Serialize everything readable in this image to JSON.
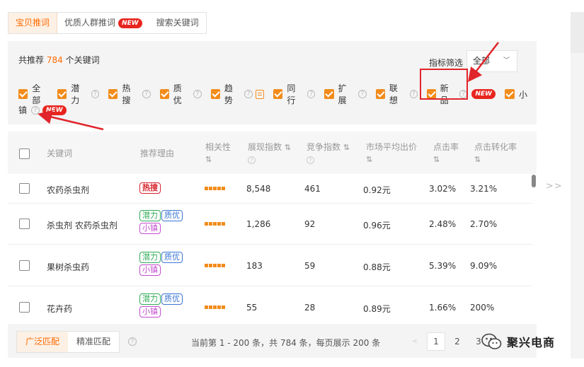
{
  "tabs": [
    {
      "label": "宝贝推词",
      "active": true
    },
    {
      "label": "优质人群推词",
      "badge": "NEW"
    },
    {
      "label": "搜索关键词"
    }
  ],
  "summary": {
    "prefix": "共推荐",
    "count": "784",
    "suffix": "个关键词"
  },
  "indicator_filter": {
    "label": "指标筛选",
    "value": "全部"
  },
  "filters_row1": [
    {
      "label": "全部",
      "help": false
    },
    {
      "label": "潜力",
      "help": true
    },
    {
      "label": "热搜",
      "help": true
    },
    {
      "label": "质优",
      "help": true
    },
    {
      "label": "趋势",
      "help": true,
      "doc_icon": true
    },
    {
      "label": "同行",
      "help": true
    },
    {
      "label": "扩展",
      "help": true
    },
    {
      "label": "联想",
      "help": true
    },
    {
      "label": "新品",
      "help": true,
      "badge": "NEW"
    },
    {
      "label": "小"
    }
  ],
  "filters_row2": {
    "label": "镇",
    "badge": "NEW"
  },
  "table": {
    "headers": [
      {
        "text": "关键词"
      },
      {
        "text": "推荐理由"
      },
      {
        "text": "相关性",
        "sort": "⇅"
      },
      {
        "text": "展现指数",
        "sort": "⇅"
      },
      {
        "text": "竞争指数",
        "sort": "⇅"
      },
      {
        "text": "市场平均出价",
        "sort": "⇅"
      },
      {
        "text": "点击率",
        "sort": "⇅"
      },
      {
        "text": "点击转化率",
        "sort": "⇅"
      }
    ],
    "rows": [
      {
        "keyword": "农药杀虫剂",
        "tags": [
          {
            "text": "热搜",
            "type": "hot"
          }
        ],
        "relevance": 5,
        "impressions": "8,548",
        "competition": "461",
        "avg_bid": "0.92元",
        "ctr": "3.02%",
        "cvr": "3.21%"
      },
      {
        "keyword": "杀虫剂 农药杀虫剂",
        "tags": [
          {
            "text": "潜力",
            "type": "potential"
          },
          {
            "text": "质优",
            "type": "quality"
          },
          {
            "text": "小镇",
            "type": "town"
          }
        ],
        "relevance": 5,
        "impressions": "1,286",
        "competition": "92",
        "avg_bid": "0.96元",
        "ctr": "2.48%",
        "cvr": "2.70%"
      },
      {
        "keyword": "果树杀虫药",
        "tags": [
          {
            "text": "潜力",
            "type": "potential"
          },
          {
            "text": "质优",
            "type": "quality"
          },
          {
            "text": "小镇",
            "type": "town"
          }
        ],
        "relevance": 5,
        "impressions": "183",
        "competition": "59",
        "avg_bid": "0.88元",
        "ctr": "5.39%",
        "cvr": "9.09%"
      },
      {
        "keyword": "花卉药",
        "tags": [
          {
            "text": "潜力",
            "type": "potential"
          },
          {
            "text": "质优",
            "type": "quality"
          },
          {
            "text": "小镇",
            "type": "town"
          }
        ],
        "relevance": 5,
        "impressions": "55",
        "competition": "28",
        "avg_bid": "0.89元",
        "ctr": "1.66%",
        "cvr": "200%"
      }
    ]
  },
  "expand_label": ">>",
  "footer": {
    "match_buttons": [
      {
        "label": "广泛匹配",
        "active": true
      },
      {
        "label": "精准匹配"
      }
    ],
    "page_info": "当前第 1 - 200 条，共 784 条，每页展示 200 条",
    "pages": [
      "1",
      "2",
      "3"
    ],
    "current_page": "1"
  },
  "watermark": {
    "text": "聚兴电商"
  },
  "colors": {
    "accent": "#ff6a00",
    "checkbox": "#f28c1b",
    "highlight": "#e0252b",
    "new_badge": "#e8251e"
  }
}
